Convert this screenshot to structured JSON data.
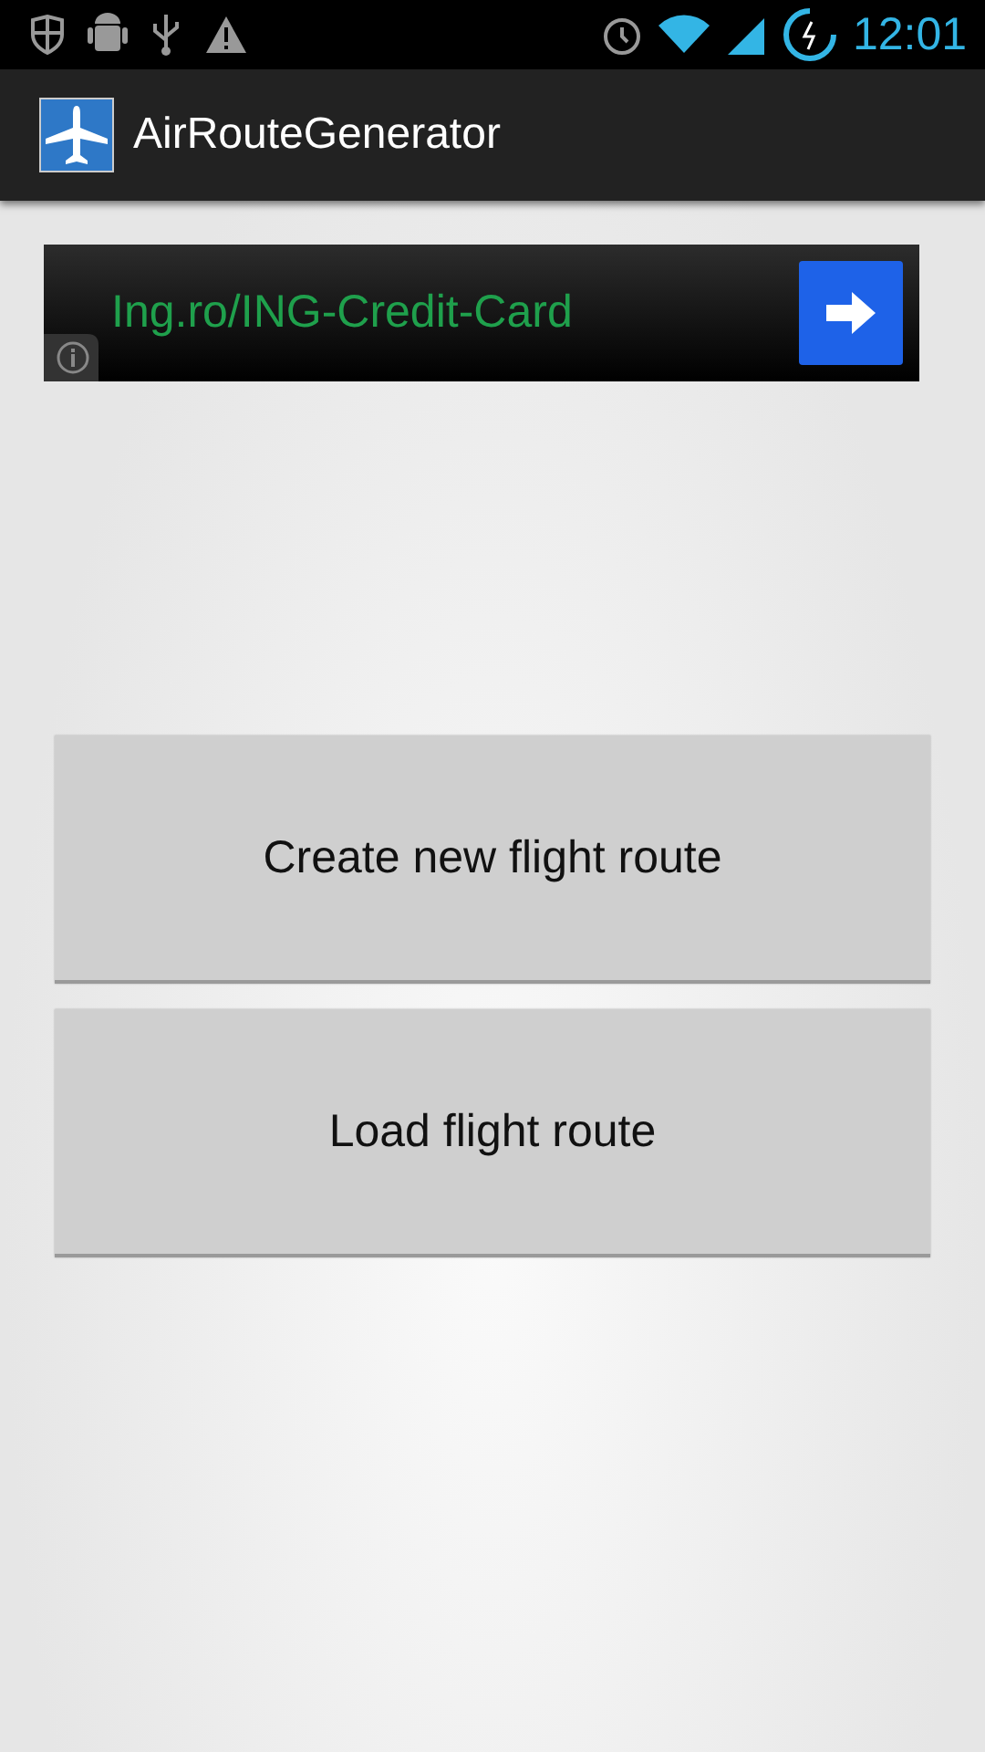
{
  "status_bar": {
    "time": "12:01"
  },
  "app_bar": {
    "title": "AirRouteGenerator"
  },
  "ad": {
    "text": "Ing.ro/ING-Credit-Card"
  },
  "buttons": [
    {
      "label": "Create new flight route"
    },
    {
      "label": "Load flight route"
    }
  ]
}
